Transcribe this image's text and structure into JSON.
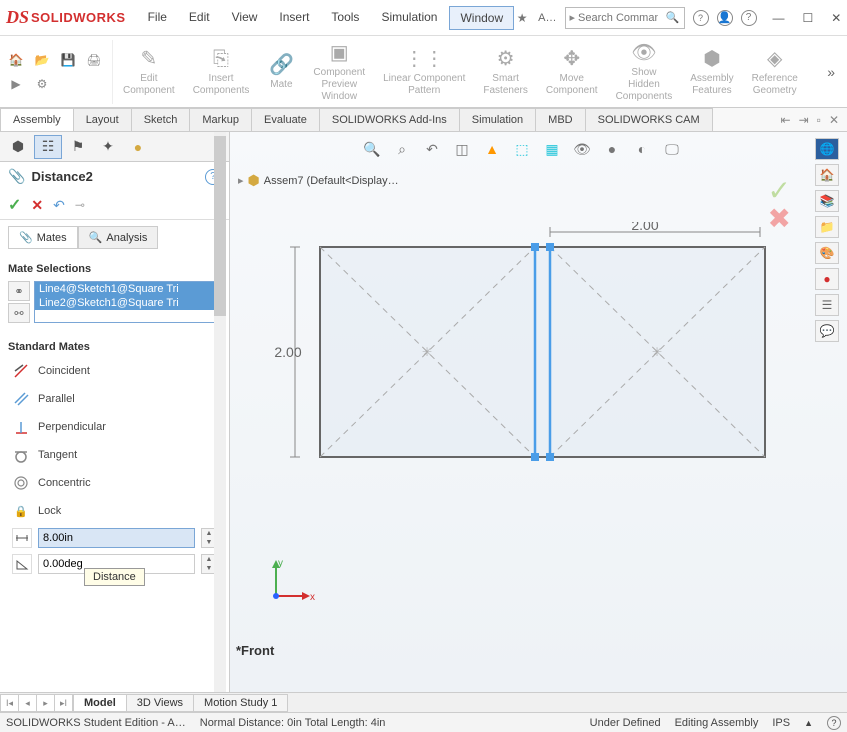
{
  "app": {
    "logo_prefix": "DS",
    "logo_text": "SOLIDWORKS"
  },
  "menu": {
    "file": "File",
    "edit": "Edit",
    "view": "View",
    "insert": "Insert",
    "tools": "Tools",
    "simulation": "Simulation",
    "window": "Window"
  },
  "search": {
    "placeholder": "Search Comman",
    "side_label": "A…"
  },
  "ribbon": {
    "edit_component": "Edit\nComponent",
    "insert_components": "Insert\nComponents",
    "mate": "Mate",
    "component_preview": "Component\nPreview\nWindow",
    "linear_pattern": "Linear Component\nPattern",
    "smart_fasteners": "Smart\nFasteners",
    "move_component": "Move\nComponent",
    "show_hidden": "Show\nHidden\nComponents",
    "assembly_features": "Assembly\nFeatures",
    "reference_geometry": "Reference\nGeometry"
  },
  "tabs": {
    "assembly": "Assembly",
    "layout": "Layout",
    "sketch": "Sketch",
    "markup": "Markup",
    "evaluate": "Evaluate",
    "addins": "SOLIDWORKS Add-Ins",
    "simulation": "Simulation",
    "mbd": "MBD",
    "cam": "SOLIDWORKS CAM"
  },
  "pm": {
    "title": "Distance2",
    "mates_tab": "Mates",
    "analysis_tab": "Analysis",
    "mate_selections": "Mate Selections",
    "selections": {
      "a": "Line4@Sketch1@Square Tri",
      "b": "Line2@Sketch1@Square Tri"
    },
    "standard_mates": "Standard Mates",
    "coincident": "Coincident",
    "parallel": "Parallel",
    "perpendicular": "Perpendicular",
    "tangent": "Tangent",
    "concentric": "Concentric",
    "lock": "Lock",
    "distance_tooltip": "Distance",
    "distance_value": "8.00in",
    "angle_value": "0.00deg"
  },
  "doc": {
    "name": "Assem7  (Default<Display…"
  },
  "dims": {
    "w": "2.00",
    "h": "2.00"
  },
  "triad": {
    "x": "x",
    "y": "y"
  },
  "view_label": "*Front",
  "btm_tabs": {
    "model": "Model",
    "views3d": "3D Views",
    "motion": "Motion Study 1"
  },
  "status": {
    "left": "SOLIDWORKS Student Edition - A…",
    "mid": "Normal Distance: 0in Total Length: 4in",
    "under": "Under Defined",
    "editing": "Editing Assembly",
    "units": "IPS"
  }
}
